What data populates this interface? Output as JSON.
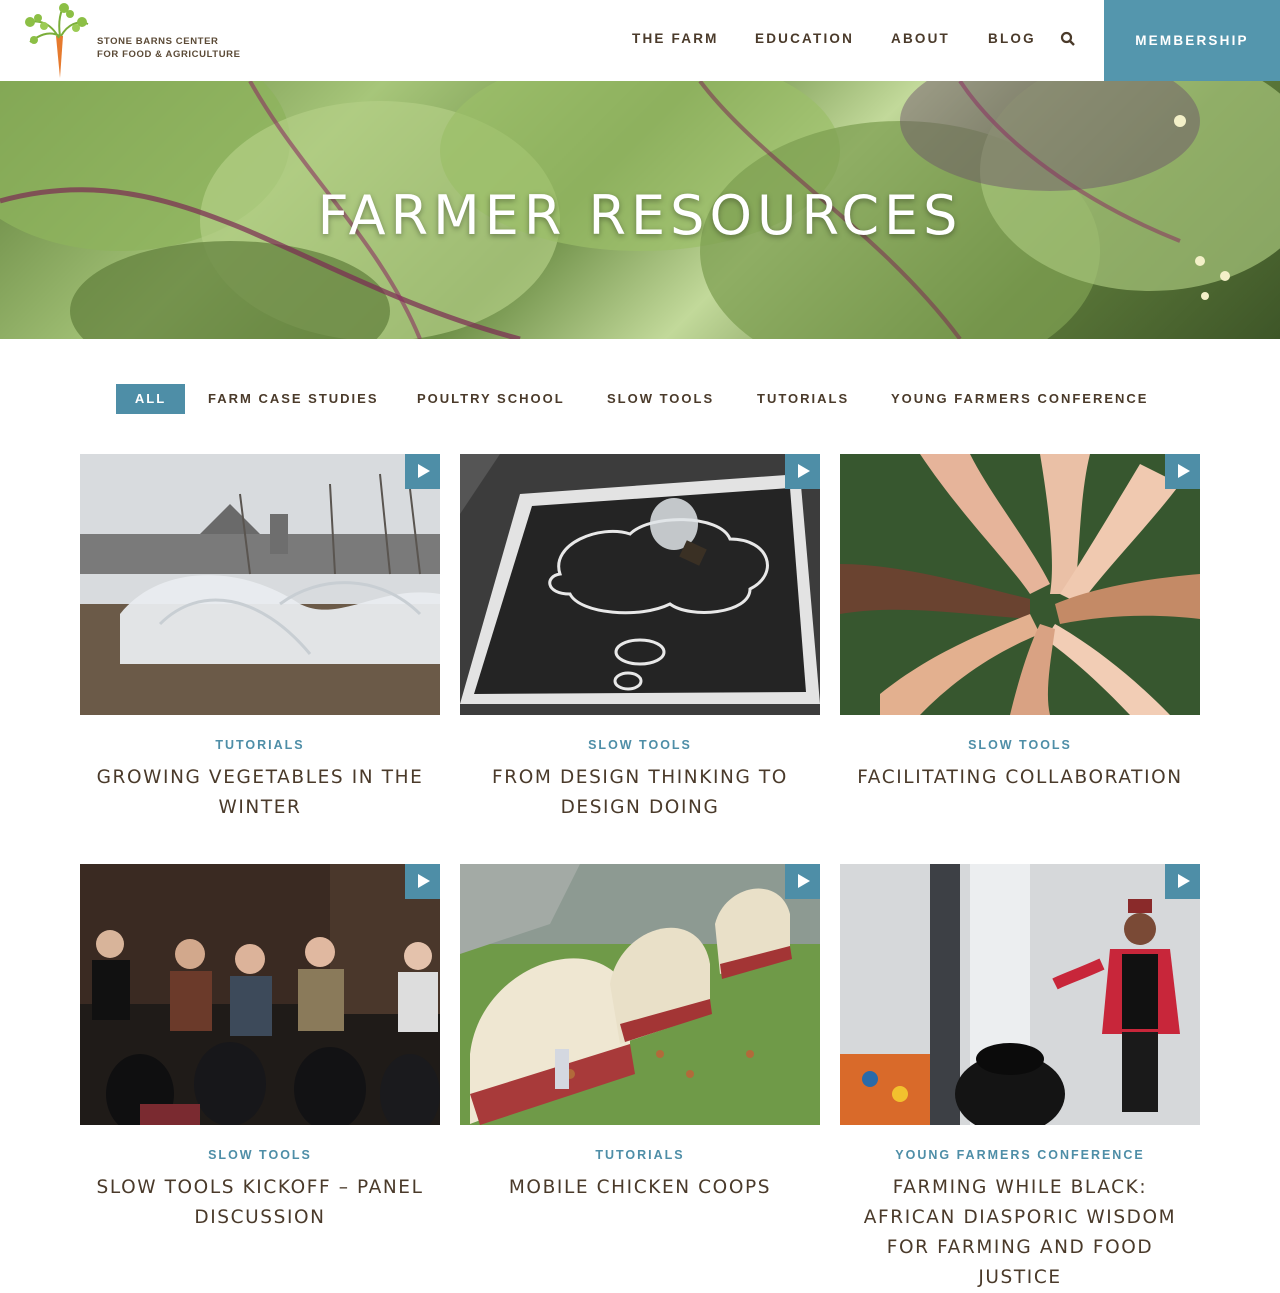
{
  "logo": {
    "line1": "STONE BARNS CENTER",
    "line2": "FOR FOOD & AGRICULTURE",
    "icon": "carrot-logo-icon"
  },
  "nav": {
    "items": [
      "THE FARM",
      "EDUCATION",
      "ABOUT",
      "BLOG"
    ],
    "search_icon": "search-icon",
    "membership": "MEMBERSHIP"
  },
  "hero": {
    "title": "FARMER RESOURCES"
  },
  "filters": [
    "ALL",
    "FARM CASE STUDIES",
    "POULTRY SCHOOL",
    "SLOW TOOLS",
    "TUTORIALS",
    "YOUNG FARMERS CONFERENCE"
  ],
  "filter_active": "ALL",
  "cards": [
    {
      "category": "TUTORIALS",
      "title": "GROWING VEGETABLES IN THE WINTER",
      "icon": "video-play-icon"
    },
    {
      "category": "SLOW TOOLS",
      "title": "FROM DESIGN THINKING TO DESIGN DOING",
      "icon": "video-play-icon"
    },
    {
      "category": "SLOW TOOLS",
      "title": "FACILITATING COLLABORATION",
      "icon": "video-play-icon"
    },
    {
      "category": "SLOW TOOLS",
      "title": "SLOW TOOLS KICKOFF – PANEL DISCUSSION",
      "icon": "video-play-icon"
    },
    {
      "category": "TUTORIALS",
      "title": "MOBILE CHICKEN COOPS",
      "icon": "video-play-icon"
    },
    {
      "category": "YOUNG FARMERS CONFERENCE",
      "title": "FARMING WHILE BLACK: AFRICAN DIASPORIC WISDOM FOR FARMING AND FOOD JUSTICE",
      "icon": "video-play-icon"
    }
  ],
  "colors": {
    "accent": "#4e8ea7",
    "membership": "#5496ad",
    "text": "#4a3a2a"
  }
}
